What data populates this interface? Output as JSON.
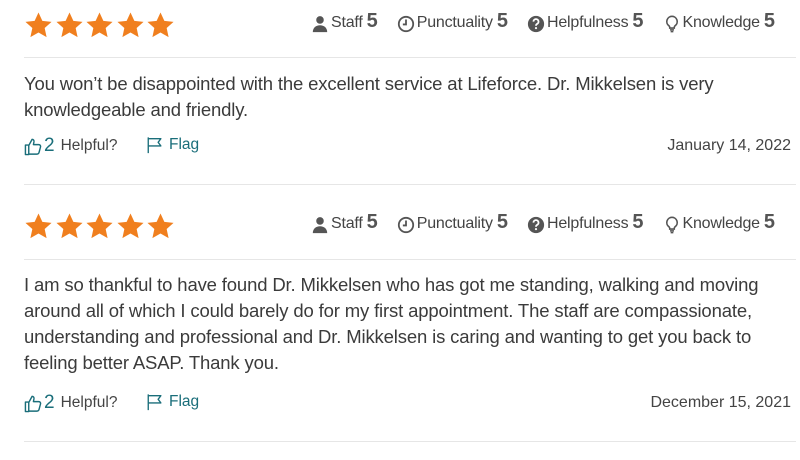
{
  "colors": {
    "star": "#f07f1e",
    "accent": "#1a6e7a",
    "text": "#3b3b3b",
    "divider": "#e6e6e6"
  },
  "reviews": [
    {
      "stars": 5,
      "metrics": [
        {
          "label": "Staff",
          "value": "5",
          "icon": "person-icon"
        },
        {
          "label": "Punctuality",
          "value": "5",
          "icon": "clock-icon"
        },
        {
          "label": "Helpfulness",
          "value": "5",
          "icon": "question-icon"
        },
        {
          "label": "Knowledge",
          "value": "5",
          "icon": "lightbulb-icon"
        }
      ],
      "text": "You won’t be disappointed with the excellent service at Lifeforce. Dr. Mikkelsen is very knowledgeable and friendly.",
      "helpful_count": "2",
      "helpful_label": "Helpful?",
      "flag_label": "Flag",
      "date": "January 14, 2022"
    },
    {
      "stars": 5,
      "metrics": [
        {
          "label": "Staff",
          "value": "5",
          "icon": "person-icon"
        },
        {
          "label": "Punctuality",
          "value": "5",
          "icon": "clock-icon"
        },
        {
          "label": "Helpfulness",
          "value": "5",
          "icon": "question-icon"
        },
        {
          "label": "Knowledge",
          "value": "5",
          "icon": "lightbulb-icon"
        }
      ],
      "text": "I am so thankful to have found Dr. Mikkelsen who has got me standing, walking and moving around all of which I could barely do for my first appointment. The staff are compassionate, understanding and professional and Dr. Mikkelsen is caring and wanting to get you back to feeling better ASAP. Thank you.",
      "helpful_count": "2",
      "helpful_label": "Helpful?",
      "flag_label": "Flag",
      "date": "December 15, 2021"
    }
  ]
}
